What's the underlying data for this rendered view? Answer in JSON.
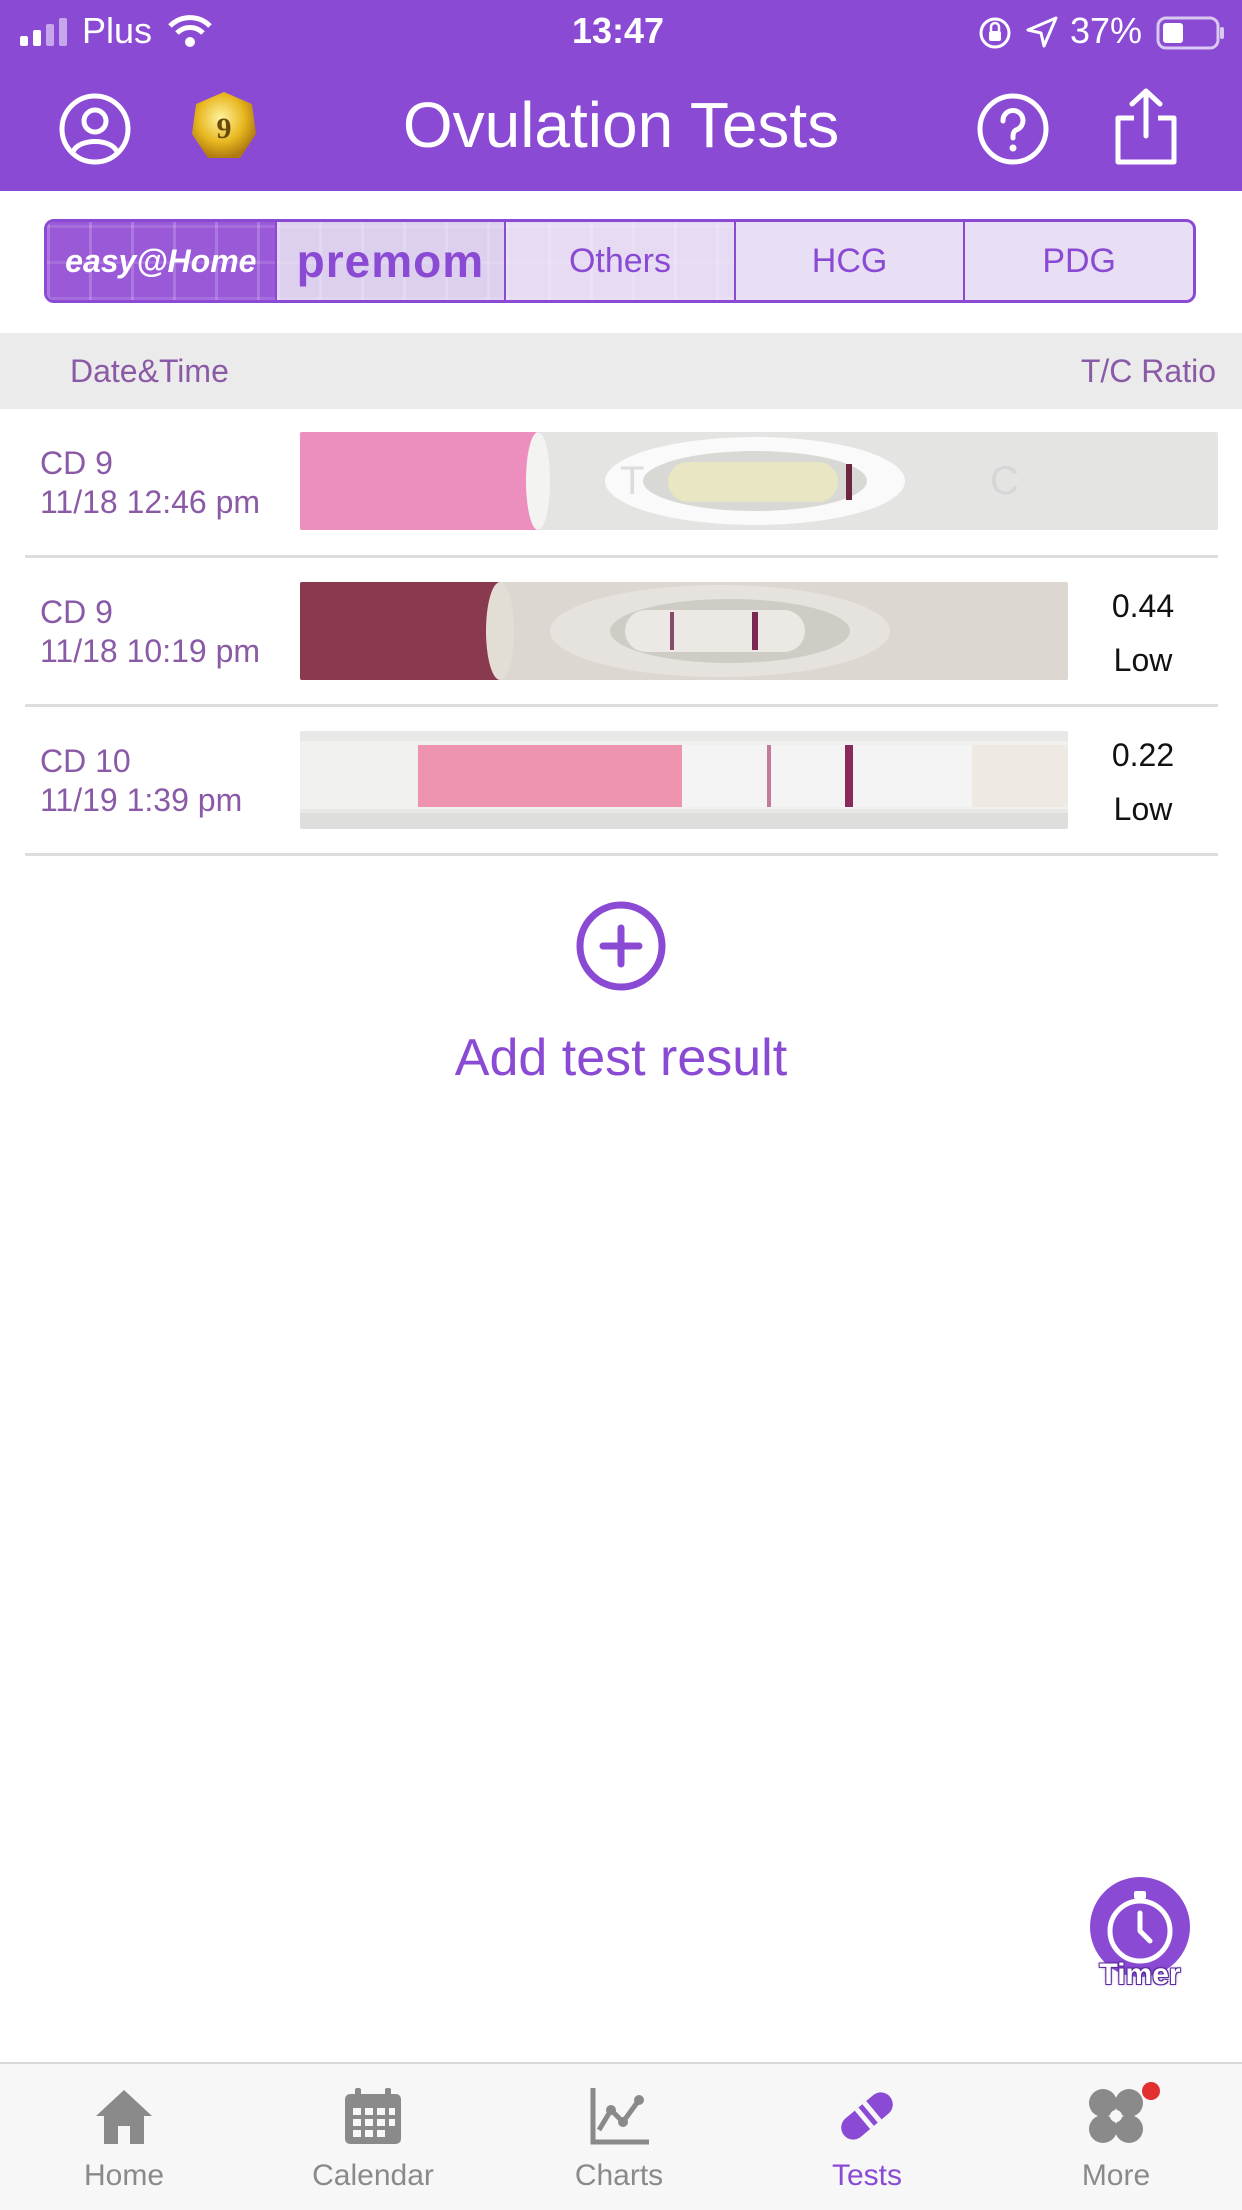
{
  "status_bar": {
    "carrier": "Plus",
    "time": "13:47",
    "battery": "37%"
  },
  "header": {
    "title": "Ovulation Tests",
    "badge_number": "9",
    "icons": [
      "profile-icon",
      "badge-icon",
      "help-icon",
      "share-icon"
    ]
  },
  "brand_tabs": {
    "easyhome": "easy@Home",
    "premom": "premom",
    "others": "Others",
    "hcg": "HCG",
    "pdg": "PDG"
  },
  "columns": {
    "date_time": "Date&Time",
    "tc_ratio": "T/C Ratio"
  },
  "results": [
    {
      "cycle_day": "CD 9",
      "datetime": "11/18 12:46 pm",
      "ratio": "",
      "level": ""
    },
    {
      "cycle_day": "CD 9",
      "datetime": "11/18 10:19 pm",
      "ratio": "0.44",
      "level": "Low"
    },
    {
      "cycle_day": "CD 10",
      "datetime": "11/19 1:39 pm",
      "ratio": "0.22",
      "level": "Low"
    }
  ],
  "add_test": {
    "label": "Add test result"
  },
  "timer": {
    "label": "Timer"
  },
  "tabbar": {
    "items": [
      {
        "label": "Home",
        "icon": "home-icon"
      },
      {
        "label": "Calendar",
        "icon": "calendar-icon"
      },
      {
        "label": "Charts",
        "icon": "chart-icon"
      },
      {
        "label": "Tests",
        "icon": "test-strip-icon"
      },
      {
        "label": "More",
        "icon": "more-icon"
      }
    ],
    "active": "Tests"
  },
  "colors": {
    "accent": "#8a4ad4",
    "text_muted": "#8b5aa6"
  }
}
